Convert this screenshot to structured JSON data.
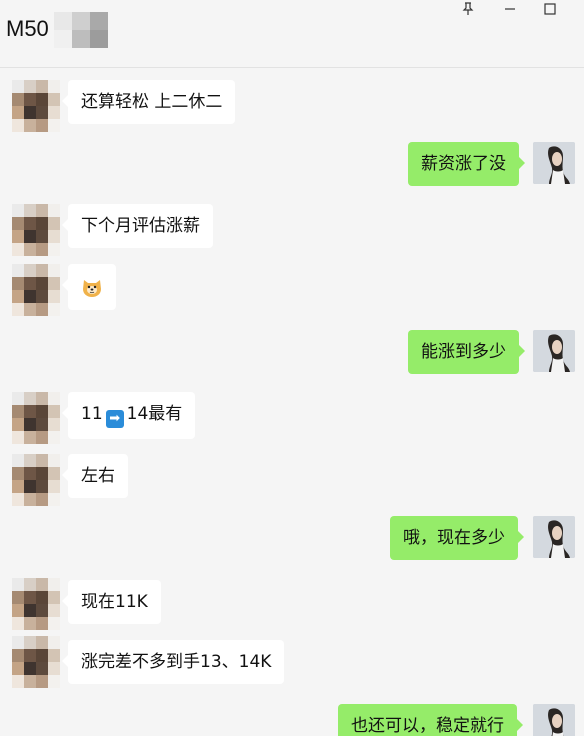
{
  "window": {
    "title": "M50",
    "pin_icon": "pin-icon",
    "minimize_icon": "minimize-icon",
    "maximize_icon": "maximize-icon"
  },
  "messages": [
    {
      "side": "left",
      "text": "还算轻松 上二休二"
    },
    {
      "side": "right",
      "text": "薪资涨了没"
    },
    {
      "side": "left",
      "text": "下个月评估涨薪"
    },
    {
      "side": "left",
      "emoji": "doge-emoji"
    },
    {
      "side": "right",
      "text": "能涨到多少"
    },
    {
      "side": "left",
      "text_before": "11",
      "inline_emoji": "right-arrow-emoji",
      "text_after": "14最有"
    },
    {
      "side": "left",
      "text": "左右"
    },
    {
      "side": "right",
      "text": "哦，现在多少"
    },
    {
      "side": "left",
      "text": "现在11K"
    },
    {
      "side": "left",
      "text": "涨完差不多到手13、14K"
    },
    {
      "side": "right",
      "text": "也还可以，稳定就行"
    }
  ],
  "colors": {
    "background": "#f5f5f5",
    "left_bubble": "#ffffff",
    "right_bubble": "#95ec69"
  }
}
